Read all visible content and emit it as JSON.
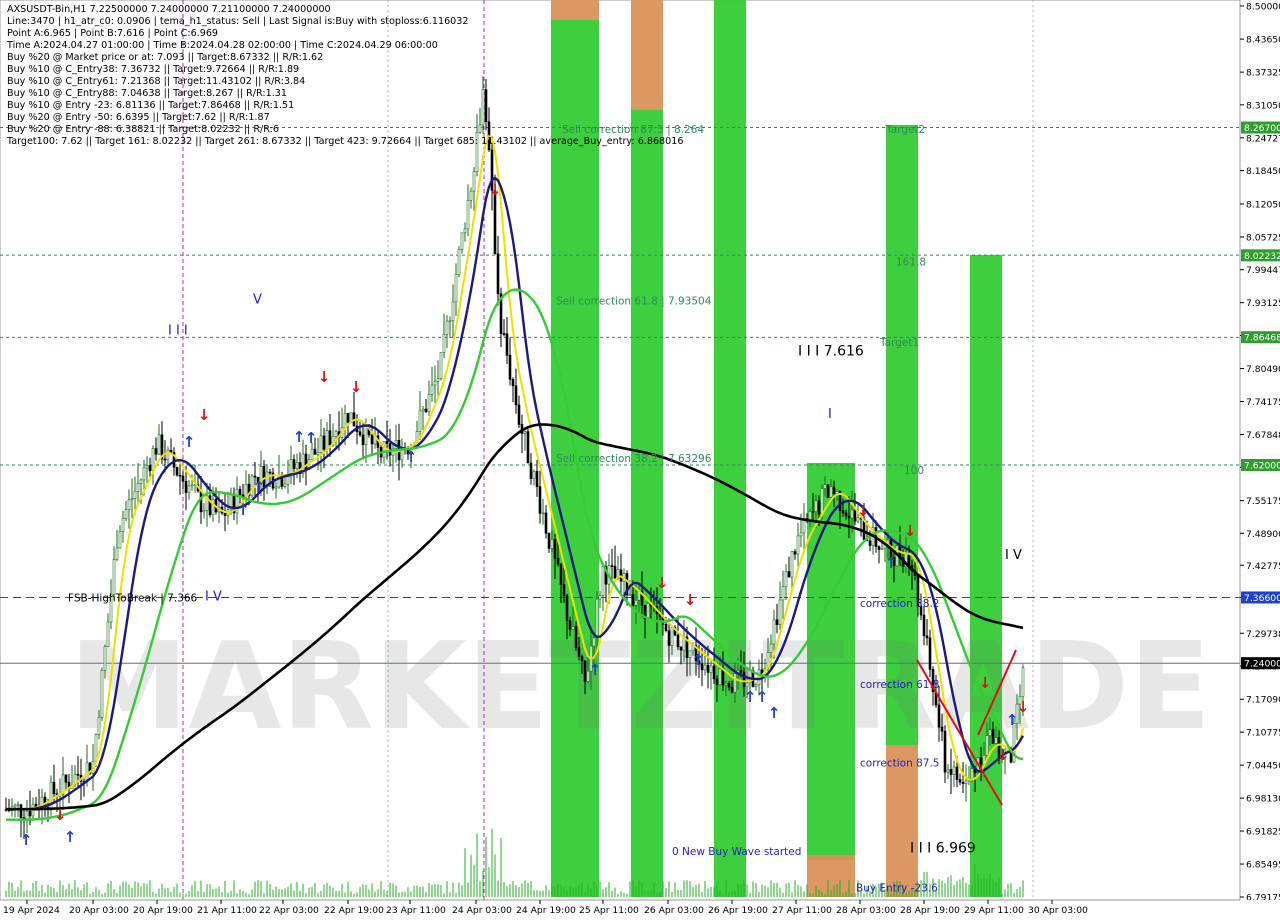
{
  "info_lines": [
    "AXSUSDT-Bin,H1  7.22500000 7.24000000 7.21100000 7.24000000",
    "Line:3470  |  h1_atr_c0: 0.0906  |  tema_h1_status: Sell  |  Last Signal is:Buy with stoploss:6.116032",
    "Point A:6.965  |  Point B:7.616  |  Point C:6.969",
    "Time A:2024.04.27 01:00:00  |  Time B:2024.04.28 02:00:00  |  Time C:2024.04.29 06:00:00",
    "Buy %20 @ Market price or at: 7.093  ||  Target:8.67332  ||  R/R:1.62",
    "Buy %10 @ C_Entry38: 7.36732  ||  Target:9.72664  ||  R/R:1.89",
    "Buy %10 @ C_Entry61: 7.21368  ||  Target:11.43102  ||  R/R:3.84",
    "Buy %10 @ C_Entry88: 7.04638  ||  Target:8.267  ||  R/R:1.31",
    "Buy %10 @ Entry -23: 6.81136  ||  Target:7.86468  ||  R/R:1.51",
    "Buy %20 @ Entry -50: 6.6395  ||  Target:7.62  ||  R/R:1.87",
    "Buy %20 @ Entry -88: 6.38821  ||  Target:8.02232  ||  R/R:6",
    "Target100: 7.62  ||  Target 161: 8.02232  ||  Target 261: 8.67332  ||  Target 423: 9.72664  ||  Target 685: 11.43102  ||  average_Buy_entry: 6.868016"
  ],
  "price_axis_ticks": [
    "8.50000",
    "8.43650",
    "8.37325",
    "8.31050",
    "8.24727",
    "8.18450",
    "8.12050",
    "8.05725",
    "7.99447",
    "7.93125",
    "7.86825",
    "7.80490",
    "7.74175",
    "7.67848",
    "7.61550",
    "7.55175",
    "7.48900",
    "7.42775",
    "7.36600",
    "7.29738",
    "7.23450",
    "7.17090",
    "7.10775",
    "7.04450",
    "6.98130",
    "6.91825",
    "6.85495",
    "6.79175"
  ],
  "time_axis_ticks": [
    "19 Apr 2024",
    "20 Apr 03:00",
    "20 Apr 19:00",
    "21 Apr 11:00",
    "22 Apr 03:00",
    "22 Apr 19:00",
    "23 Apr 11:00",
    "24 Apr 03:00",
    "24 Apr 19:00",
    "25 Apr 11:00",
    "26 Apr 03:00",
    "26 Apr 19:00",
    "27 Apr 11:00",
    "28 Apr 03:00",
    "28 Apr 19:00",
    "29 Apr 11:00",
    "30 Apr 03:00"
  ],
  "level_labels": [
    {
      "text": "Sell correction 87.5 | 8.264",
      "price": 8.264,
      "color": "#2e8b57"
    },
    {
      "text": "Sell correction 61.8 | 7.93504",
      "price": 7.935,
      "color": "#2e8b57"
    },
    {
      "text": "Sell correction 38.2 | 7.63296",
      "price": 7.633,
      "color": "#2e8b57"
    },
    {
      "text": "FSB-HighToBreak | 7.366",
      "price": 7.366,
      "color": "#000000"
    },
    {
      "text": "Target2",
      "price": 8.264,
      "color": "#2e8b57"
    },
    {
      "text": "161.8",
      "price": 8.01,
      "color": "#2e8b57"
    },
    {
      "text": "Target1",
      "price": 7.856,
      "color": "#2e8b57"
    },
    {
      "text": "100",
      "price": 7.61,
      "color": "#2e8b57"
    },
    {
      "text": "correction 38.2",
      "price": 7.355,
      "color": "#1e1ecc"
    },
    {
      "text": "correction 61.8",
      "price": 7.2,
      "color": "#1e1ecc"
    },
    {
      "text": "correction 87.5",
      "price": 7.05,
      "color": "#1e1ecc"
    },
    {
      "text": "0 New Buy Wave started",
      "price": 6.88,
      "color": "#1e1ecc"
    },
    {
      "text": "Buy Entry -23.6",
      "price": 6.81,
      "color": "#1e1ecc"
    }
  ],
  "wave_labels": [
    {
      "text": "I I I",
      "price": 7.87
    },
    {
      "text": "V",
      "price": 7.93
    },
    {
      "text": "I V",
      "price": 7.36
    },
    {
      "text": "I I I 7.616",
      "price": 7.83
    },
    {
      "text": "I",
      "price": 7.71
    },
    {
      "text": "I V",
      "price": 7.44
    },
    {
      "text": "I I I 6.969",
      "price": 6.877
    }
  ],
  "right_axis_badges": [
    {
      "text": "8.26700",
      "price": 8.267,
      "color": "#2e9e2e"
    },
    {
      "text": "8.02232",
      "price": 8.022,
      "color": "#2e9e2e"
    },
    {
      "text": "7.86468",
      "price": 7.865,
      "color": "#2e9e2e"
    },
    {
      "text": "7.62000",
      "price": 7.62,
      "color": "#2e9e2e"
    },
    {
      "text": "7.36600",
      "price": 7.366,
      "color": "#1f3fcf"
    },
    {
      "text": "7.24000",
      "price": 7.24,
      "color": "#000000"
    }
  ],
  "watermark": "MARKETZITRADE",
  "colors": {
    "green_zone": "#33cc33",
    "orange_zone": "#d9925a",
    "bull_candle": "#1e6e1e",
    "bear_candle": "#000000",
    "ma_navy": "#1a1a80",
    "ma_yellow": "#f0e000",
    "ma_green": "#33cc33",
    "ma_black": "#000000",
    "buy_arrow": "#1f3fcf",
    "sell_arrow": "#e01010",
    "level_green": "#2e8b57"
  },
  "chart_data": {
    "type": "candlestick",
    "title": "AXSUSDT-Bin,H1",
    "ylim": [
      6.79175,
      8.5
    ],
    "last_price": 7.24,
    "x_range": [
      "2024-04-19 00:00",
      "2024-04-30 06:00"
    ],
    "horizontal_levels": [
      8.267,
      8.02232,
      7.86468,
      7.62,
      7.366,
      7.24
    ],
    "approx_close_path": [
      {
        "time": "19 Apr 2024",
        "price": 6.98
      },
      {
        "time": "20 Apr 03:00",
        "price": 7.05
      },
      {
        "time": "20 Apr 19:00",
        "price": 7.66
      },
      {
        "time": "21 Apr 11:00",
        "price": 7.52
      },
      {
        "time": "22 Apr 03:00",
        "price": 7.6
      },
      {
        "time": "22 Apr 19:00",
        "price": 7.72
      },
      {
        "time": "23 Apr 11:00",
        "price": 7.66
      },
      {
        "time": "24 Apr 03:00",
        "price": 8.1
      },
      {
        "time": "24 Apr 19:00",
        "price": 7.55
      },
      {
        "time": "25 Apr 11:00",
        "price": 7.3
      },
      {
        "time": "26 Apr 03:00",
        "price": 7.3
      },
      {
        "time": "26 Apr 19:00",
        "price": 7.2
      },
      {
        "time": "27 Apr 11:00",
        "price": 7.47
      },
      {
        "time": "28 Apr 03:00",
        "price": 7.5
      },
      {
        "time": "28 Apr 19:00",
        "price": 7.1
      },
      {
        "time": "29 Apr 11:00",
        "price": 7.1
      },
      {
        "time": "30 Apr 03:00",
        "price": 7.24
      }
    ]
  }
}
